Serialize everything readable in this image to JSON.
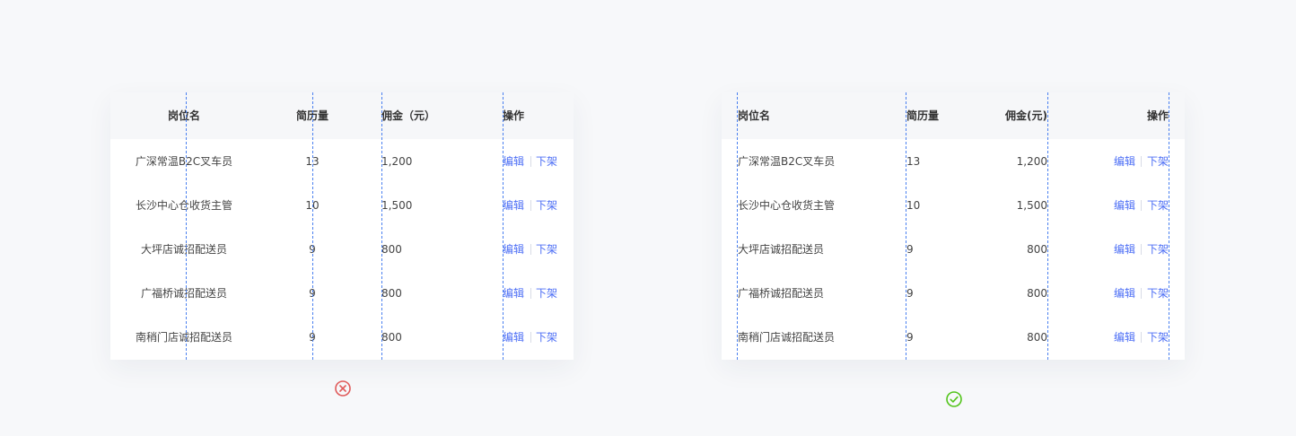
{
  "panels": [
    {
      "id": "wrong",
      "alignment": "all columns center/left mixed alignment (incorrect)",
      "headers": [
        "岗位名",
        "简历量",
        "佣金（元）",
        "操作"
      ],
      "rows": [
        [
          "广深常温B2C叉车员",
          "13",
          "1,200"
        ],
        [
          "长沙中心仓收货主管",
          "10",
          "1,500"
        ],
        [
          "大坪店诚招配送员",
          "9",
          "800"
        ],
        [
          "广福桥诚招配送员",
          "9",
          "800"
        ],
        [
          "南稍门店诚招配送员",
          "9",
          "800"
        ]
      ],
      "actions": [
        "编辑",
        "下架"
      ],
      "status_icon": "error-circle-icon",
      "status_color": "#e05a5a"
    },
    {
      "id": "right",
      "alignment": "text left, numbers right, actions right (correct)",
      "headers": [
        "岗位名",
        "简历量",
        "佣金(元)",
        "操作"
      ],
      "rows": [
        [
          "广深常温B2C叉车员",
          "13",
          "1,200"
        ],
        [
          "长沙中心仓收货主管",
          "10",
          "1,500"
        ],
        [
          "大坪店诚招配送员",
          "9",
          "800"
        ],
        [
          "广福桥诚招配送员",
          "9",
          "800"
        ],
        [
          "南稍门店诚招配送员",
          "9",
          "800"
        ]
      ],
      "actions": [
        "编辑",
        "下架"
      ],
      "status_icon": "check-circle-icon",
      "status_color": "#52c41a"
    }
  ],
  "colors": {
    "guide_line": "#4a80f0",
    "action_link": "#4c6ef5",
    "header_bg": "#f6f7f9",
    "page_bg": "#f7f8fa"
  }
}
